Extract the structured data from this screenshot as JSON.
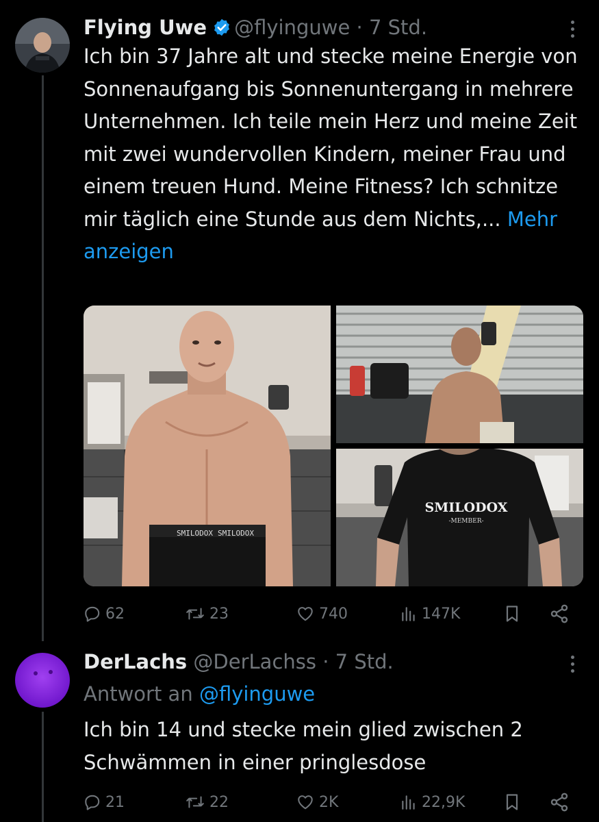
{
  "tweet1": {
    "name": "Flying Uwe",
    "handle": "@flyinguwe",
    "separator": "·",
    "time": "7 Std.",
    "text": "Ich bin 37 Jahre alt und stecke meine Energie von Sonnenaufgang bis Sonnenuntergang in mehrere Unternehmen. Ich teile mein Herz und meine Zeit mit zwei wundervollen Kindern, meiner Frau und einem treuen Hund. Meine Fitness? Ich schnitze mir täglich eine Stunde aus dem Nichts,... ",
    "show_more": "Mehr anzeigen",
    "shirt_text": "SMILODOX",
    "shirt_subtext": "-MEMBER-",
    "shorts_text": "SMILODOX",
    "replies": "62",
    "reposts": "23",
    "likes": "740",
    "views": "147K"
  },
  "tweet2": {
    "name": "DerLachs",
    "handle": "@DerLachss",
    "separator": "·",
    "time": "7 Std.",
    "reply_prefix": "Antwort an ",
    "reply_to": "@flyinguwe",
    "text": "Ich bin 14 und stecke mein glied zwischen 2 Schwämmen in einer pringlesdose",
    "replies": "21",
    "reposts": "22",
    "likes": "2K",
    "views": "22,9K"
  },
  "colors": {
    "background": "#000000",
    "text": "#e7e9ea",
    "secondary": "#71767b",
    "link": "#1d9bf0",
    "verified": "#1d9bf0",
    "avatar2": "#8a2be2"
  },
  "icons": [
    "verified-badge-icon",
    "more-icon",
    "reply-icon",
    "repost-icon",
    "like-icon",
    "views-icon",
    "bookmark-icon",
    "share-icon"
  ]
}
